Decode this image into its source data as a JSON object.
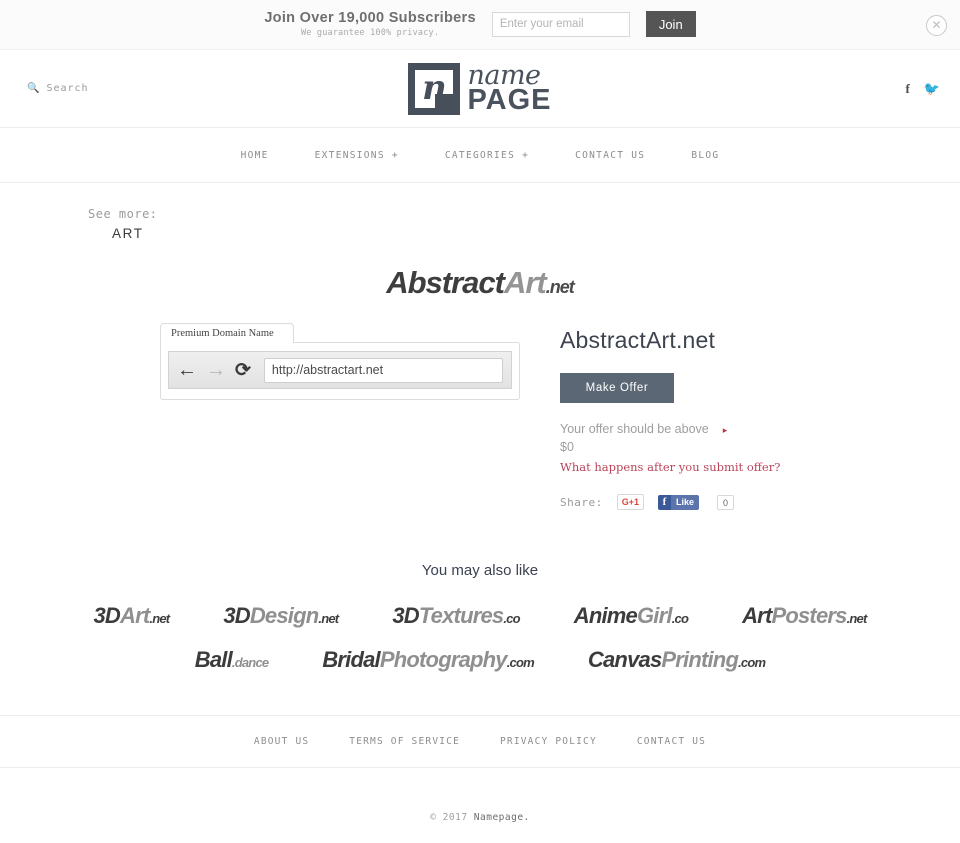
{
  "subscribe": {
    "headline": "Join Over 19,000 Subscribers",
    "subline": "We guarantee 100% privacy.",
    "email_placeholder": "Enter your email",
    "email_value": "",
    "join_label": "Join",
    "close_icon": "close-circle-icon"
  },
  "header": {
    "search_label": "Search",
    "search_icon": "search-icon",
    "logo_name": "name",
    "logo_page": "PAGE",
    "logo_letter": "n",
    "social": [
      {
        "name": "facebook-icon",
        "glyph": "f"
      },
      {
        "name": "twitter-icon",
        "glyph": "🐦"
      }
    ]
  },
  "nav": {
    "items": [
      {
        "label": "HOME"
      },
      {
        "label": "EXTENSIONS +"
      },
      {
        "label": "CATEGORIES +"
      },
      {
        "label": "CONTACT US"
      },
      {
        "label": "BLOG"
      }
    ]
  },
  "seemore": {
    "label": "See more:",
    "value": "ART"
  },
  "wordmark": {
    "part1": "Abstract",
    "part2": "Art",
    "tld": ".net"
  },
  "browser": {
    "tab_label": "Premium Domain Name",
    "url": "http://abstractart.net",
    "back_icon": "arrow-left-icon",
    "forward_icon": "arrow-right-icon",
    "reload_icon": "reload-icon"
  },
  "detail": {
    "title": "AbstractArt.net",
    "make_offer_label": "Make Offer",
    "offer_note": "Your offer should be above",
    "offer_amount": "$0",
    "offer_link": "What happens after you submit offer?",
    "share_label": "Share:",
    "gplus_label": "G+1",
    "fb_f": "f",
    "fb_like_label": "Like",
    "fb_count": "0"
  },
  "also": {
    "title": "You may also like",
    "rows": [
      [
        {
          "part1": "3D",
          "part2": "Art",
          "tld": ".net",
          "tld_gray": false
        },
        {
          "part1": "3D",
          "part2": "Design",
          "tld": ".net",
          "tld_gray": false
        },
        {
          "part1": "3D",
          "part2": "Textures",
          "tld": ".co",
          "tld_gray": false
        },
        {
          "part1": "Anime",
          "part2": "Girl",
          "tld": ".co",
          "tld_gray": false
        },
        {
          "part1": "Art",
          "part2": "Posters",
          "tld": ".net",
          "tld_gray": false
        }
      ],
      [
        {
          "part1": "Ball",
          "part2": "",
          "tld": ".dance",
          "tld_gray": true
        },
        {
          "part1": "Bridal",
          "part2": "Photography",
          "tld": ".com",
          "tld_gray": false
        },
        {
          "part1": "Canvas",
          "part2": "Printing",
          "tld": ".com",
          "tld_gray": false
        }
      ]
    ]
  },
  "footer": {
    "links": [
      {
        "label": "ABOUT US"
      },
      {
        "label": "TERMS OF SERVICE"
      },
      {
        "label": "PRIVACY POLICY"
      },
      {
        "label": "CONTACT US"
      }
    ],
    "copyright_prefix": "© 2017 ",
    "copyright_name": "Namepage."
  },
  "colors": {
    "logo_slate": "#464f5a",
    "offer_button": "#5b6775",
    "accent_red": "#b8455a",
    "facebook_blue": "#3b5998",
    "gplus_red": "#d9453b"
  }
}
